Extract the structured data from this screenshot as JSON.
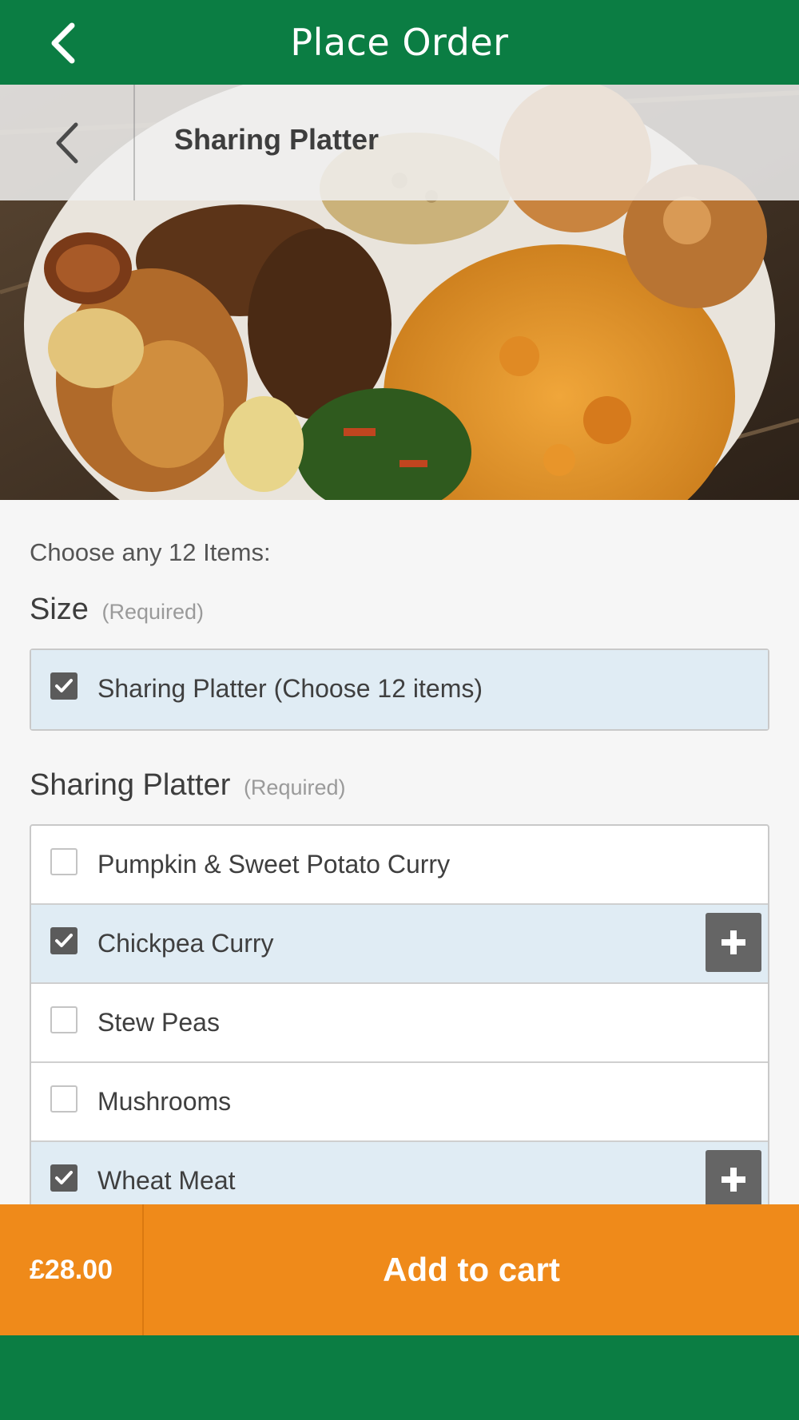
{
  "header": {
    "title": "Place Order"
  },
  "item": {
    "name": "Sharing Platter"
  },
  "instructions": "Choose any 12 Items:",
  "sections": {
    "size": {
      "title": "Size",
      "required": "(Required)",
      "options": [
        {
          "label": "Sharing Platter (Choose 12 items)",
          "checked": true
        }
      ]
    },
    "platter": {
      "title": "Sharing Platter",
      "required": "(Required)",
      "options": [
        {
          "label": "Pumpkin & Sweet Potato Curry",
          "checked": false
        },
        {
          "label": "Chickpea Curry",
          "checked": true
        },
        {
          "label": "Stew Peas",
          "checked": false
        },
        {
          "label": "Mushrooms",
          "checked": false
        },
        {
          "label": "Wheat Meat",
          "checked": true
        }
      ]
    }
  },
  "footer": {
    "price": "£28.00",
    "add_to_cart": "Add to cart"
  },
  "colors": {
    "brand_green": "#0b7d43",
    "accent_orange": "#ef8a1a",
    "selected_row": "#e0ecf4"
  },
  "icons": [
    "chevron-left-icon",
    "checkbox-icon",
    "plus-icon"
  ]
}
